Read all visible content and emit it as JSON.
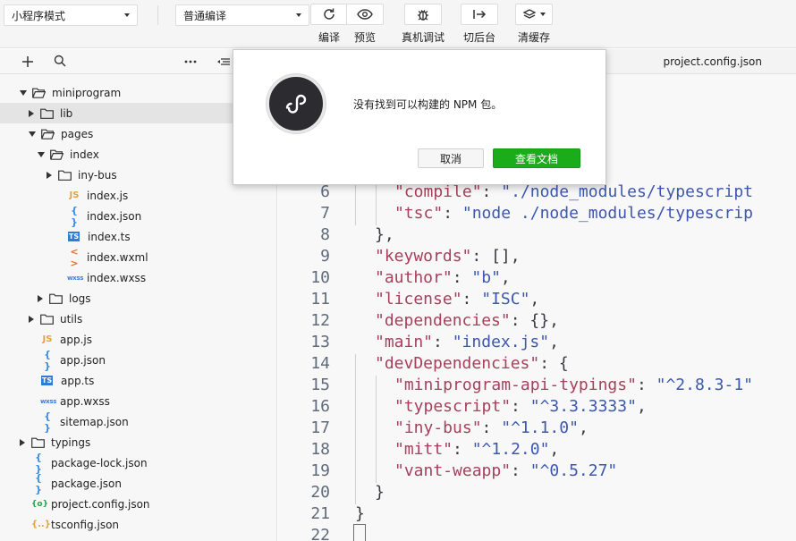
{
  "toolbar": {
    "mode_select": "小程序模式",
    "compile_select": "普通编译",
    "buttons": [
      {
        "label": "编译",
        "icon": "refresh-icon"
      },
      {
        "label": "预览",
        "icon": "eye-icon"
      },
      {
        "label": "真机调试",
        "icon": "bug-icon"
      },
      {
        "label": "切后台",
        "icon": "switch-background-icon"
      },
      {
        "label": "清缓存",
        "icon": "layers-icon"
      }
    ]
  },
  "sidebar": {
    "toolbar_icons": [
      "plus-icon",
      "search-icon",
      "more-icon",
      "collapse-icon"
    ],
    "tree": [
      {
        "name": "miniprogram",
        "type": "folder",
        "expanded": true
      },
      {
        "name": "lib",
        "type": "folder",
        "expanded": false
      },
      {
        "name": "pages",
        "type": "folder",
        "expanded": true
      },
      {
        "name": "index",
        "type": "folder",
        "expanded": true
      },
      {
        "name": "iny-bus",
        "type": "folder",
        "expanded": false
      },
      {
        "name": "index.js",
        "type": "js"
      },
      {
        "name": "index.json",
        "type": "json"
      },
      {
        "name": "index.ts",
        "type": "ts"
      },
      {
        "name": "index.wxml",
        "type": "wxml"
      },
      {
        "name": "index.wxss",
        "type": "wxss"
      },
      {
        "name": "logs",
        "type": "folder",
        "expanded": false
      },
      {
        "name": "utils",
        "type": "folder",
        "expanded": false
      },
      {
        "name": "app.js",
        "type": "js"
      },
      {
        "name": "app.json",
        "type": "json"
      },
      {
        "name": "app.ts",
        "type": "ts"
      },
      {
        "name": "app.wxss",
        "type": "wxss"
      },
      {
        "name": "sitemap.json",
        "type": "json"
      },
      {
        "name": "typings",
        "type": "folder",
        "expanded": false
      },
      {
        "name": "package-lock.json",
        "type": "json"
      },
      {
        "name": "package.json",
        "type": "json"
      },
      {
        "name": "project.config.json",
        "type": "project-config"
      },
      {
        "name": "tsconfig.json",
        "type": "tsconfig"
      }
    ],
    "file_icon_glyphs": {
      "js": "JS",
      "json": "{ }",
      "ts": "TS",
      "wxml": "< >",
      "wxss": "wxss",
      "pcfg": "{o}",
      "tscfg": "{..}"
    }
  },
  "editor": {
    "tab_title": "project.config.json",
    "line_numbers": [
      "6",
      "7",
      "8",
      "9",
      "10",
      "11",
      "12",
      "13",
      "14",
      "15",
      "16",
      "17",
      "18",
      "19",
      "20",
      "21",
      "22"
    ],
    "lines": [
      {
        "key": "\"compile\"",
        "sep": ": ",
        "val": "\"./node_modules/typescript"
      },
      {
        "key": "\"tsc\"",
        "sep": ": ",
        "val": "\"node ./node_modules/typescrip"
      },
      {
        "text": "},"
      },
      {
        "key": "\"keywords\"",
        "sep": ": ",
        "tail": "[],"
      },
      {
        "key": "\"author\"",
        "sep": ": ",
        "val": "\"b\"",
        "tail": ","
      },
      {
        "key": "\"license\"",
        "sep": ": ",
        "val": "\"ISC\"",
        "tail": ","
      },
      {
        "key": "\"dependencies\"",
        "sep": ": ",
        "tail": "{},"
      },
      {
        "key": "\"main\"",
        "sep": ": ",
        "val": "\"index.js\"",
        "tail": ","
      },
      {
        "key": "\"devDependencies\"",
        "sep": ": ",
        "tail": "{"
      },
      {
        "key": "\"miniprogram-api-typings\"",
        "sep": ": ",
        "val": "\"^2.8.3-1\""
      },
      {
        "key": "\"typescript\"",
        "sep": ": ",
        "val": "\"^3.3.3333\"",
        "tail": ","
      },
      {
        "key": "\"iny-bus\"",
        "sep": ": ",
        "val": "\"^1.1.0\"",
        "tail": ","
      },
      {
        "key": "\"mitt\"",
        "sep": ": ",
        "val": "\"^1.2.0\"",
        "tail": ","
      },
      {
        "key": "\"vant-weapp\"",
        "sep": ": ",
        "val": "\"^0.5.27\""
      },
      {
        "text": "}"
      },
      {
        "text": "}"
      },
      {
        "text": ""
      }
    ]
  },
  "dialog": {
    "message": "没有找到可以构建的 NPM 包。",
    "cancel_label": "取消",
    "docs_label": "查看文档",
    "logo_icon": "miniprogram-logo-icon",
    "accent_color": "#1aad19"
  }
}
